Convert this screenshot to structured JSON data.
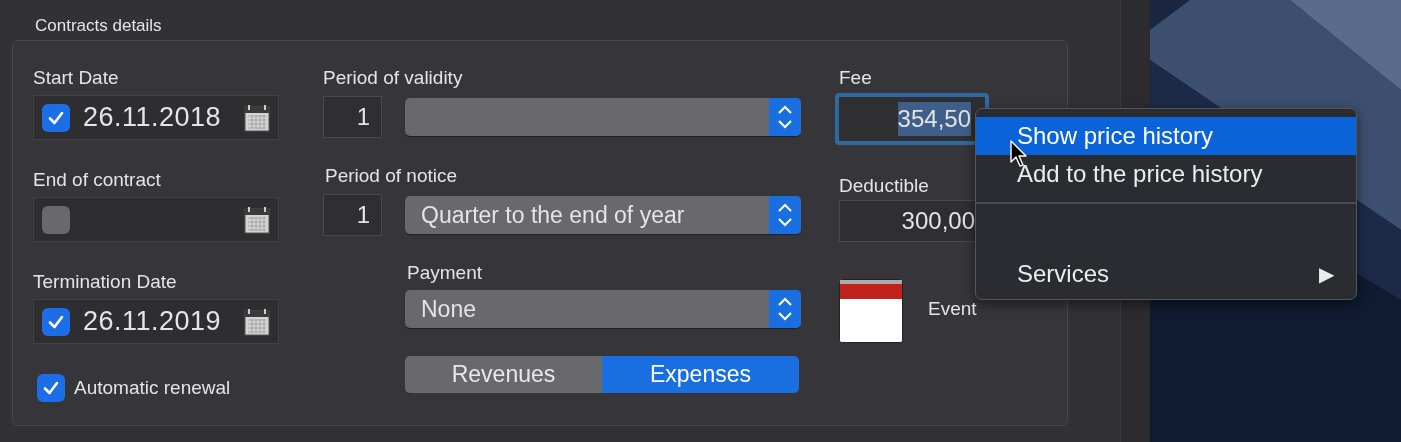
{
  "section": {
    "title": "Contracts details"
  },
  "dates": [
    {
      "label": "Start Date",
      "checked": true,
      "value": "26.11.2018"
    },
    {
      "label": "End of contract",
      "checked": false
    },
    {
      "label": "Termination Date",
      "checked": true,
      "value": "26.11.2019"
    }
  ],
  "automatic_renewal": {
    "label": "Automatic renewal",
    "checked": true
  },
  "periods": [
    {
      "label": "Period of validity",
      "count": "1"
    },
    {
      "label": "Period of notice",
      "count": "1",
      "value": "Quarter to the end of year"
    }
  ],
  "payment": {
    "label": "Payment",
    "value": "None"
  },
  "segments": [
    {
      "label": "Revenues",
      "selected": false
    },
    {
      "label": "Expenses",
      "selected": true
    }
  ],
  "fee": {
    "label": "Fee",
    "value": "354,50",
    "focused": true,
    "text_selected": true
  },
  "deductible": {
    "label": "Deductible",
    "value": "300,00"
  },
  "event": {
    "label": "Event"
  },
  "context_menu": {
    "items": [
      {
        "kind": "item",
        "label": "Show price history",
        "selected": true
      },
      {
        "kind": "item",
        "label": "Add to the price history",
        "selected": false
      },
      {
        "kind": "separator"
      },
      {
        "kind": "submenu",
        "label": "Services",
        "arrow": "▶",
        "selected": false
      }
    ]
  }
}
